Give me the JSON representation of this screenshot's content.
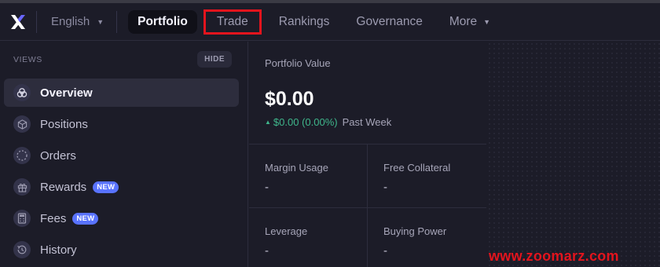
{
  "nav": {
    "language": "English",
    "items": [
      {
        "label": "Portfolio"
      },
      {
        "label": "Trade"
      },
      {
        "label": "Rankings"
      },
      {
        "label": "Governance"
      },
      {
        "label": "More"
      }
    ]
  },
  "sidebar": {
    "views_label": "VIEWS",
    "hide_label": "HIDE",
    "items": [
      {
        "label": "Overview",
        "icon": "overview-icon"
      },
      {
        "label": "Positions",
        "icon": "cube-icon"
      },
      {
        "label": "Orders",
        "icon": "dashed-circle-icon"
      },
      {
        "label": "Rewards",
        "icon": "gift-icon",
        "badge": "NEW"
      },
      {
        "label": "Fees",
        "icon": "calculator-icon",
        "badge": "NEW"
      },
      {
        "label": "History",
        "icon": "history-icon"
      }
    ]
  },
  "portfolio": {
    "label": "Portfolio Value",
    "value": "$0.00",
    "change": "$0.00 (0.00%)",
    "change_period": "Past Week",
    "stats": [
      {
        "label": "Margin Usage",
        "value": "-"
      },
      {
        "label": "Free Collateral",
        "value": "-"
      },
      {
        "label": "Leverage",
        "value": "-"
      },
      {
        "label": "Buying Power",
        "value": "-"
      }
    ]
  },
  "watermark": "www.zoomarz.com",
  "colors": {
    "background": "#1c1c28",
    "active_bg": "#2d2d3d",
    "accent_badge": "#5973fe",
    "positive": "#3fb68b",
    "highlight_red": "#e3141d"
  }
}
